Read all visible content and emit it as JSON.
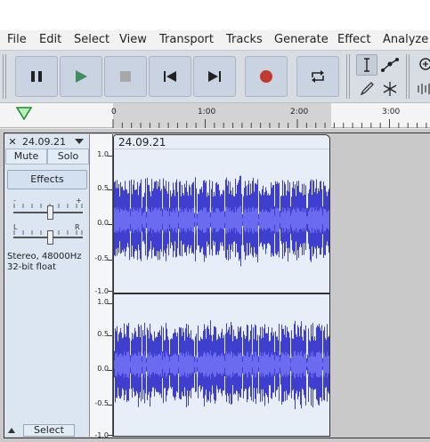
{
  "menu": [
    "File",
    "Edit",
    "Select",
    "View",
    "Transport",
    "Tracks",
    "Generate",
    "Effect",
    "Analyze"
  ],
  "transport_buttons": [
    {
      "name": "pause-icon",
      "label": "Pause"
    },
    {
      "name": "play-icon",
      "label": "Play"
    },
    {
      "name": "stop-icon",
      "label": "Stop"
    },
    {
      "name": "skip-to-start-icon",
      "label": "Skip to Start"
    },
    {
      "name": "skip-to-end-icon",
      "label": "Skip to End"
    },
    {
      "name": "record-icon",
      "label": "Record"
    },
    {
      "name": "loop-icon",
      "label": "Loop"
    }
  ],
  "tools": [
    "selection-tool-icon",
    "envelope-tool-icon",
    "draw-tool-icon",
    "multi-tool-icon",
    "zoom-in-icon",
    "level-meter-icon"
  ],
  "ruler": {
    "labels": [
      "0",
      "1:00",
      "2:00",
      "3:00"
    ]
  },
  "track": {
    "name": "24.09.21",
    "mute": "Mute",
    "solo": "Solo",
    "effects": "Effects",
    "gain_minus": "-",
    "gain_plus": "+",
    "pan_left": "L",
    "pan_right": "R",
    "info_line1": "Stereo, 48000Hz",
    "info_line2": "32-bit float",
    "select": "Select",
    "clip_name": "24.09.21",
    "scale_labels": [
      "1.0",
      "0.5",
      "0.0",
      "-0.5",
      "-1.0"
    ]
  },
  "colors": {
    "waveform": "#3f3fcf",
    "waveform_rms": "#6b6bf0",
    "record": "#c13a2e",
    "play": "#3f8f5e",
    "accent_green": "#2fa83f"
  }
}
